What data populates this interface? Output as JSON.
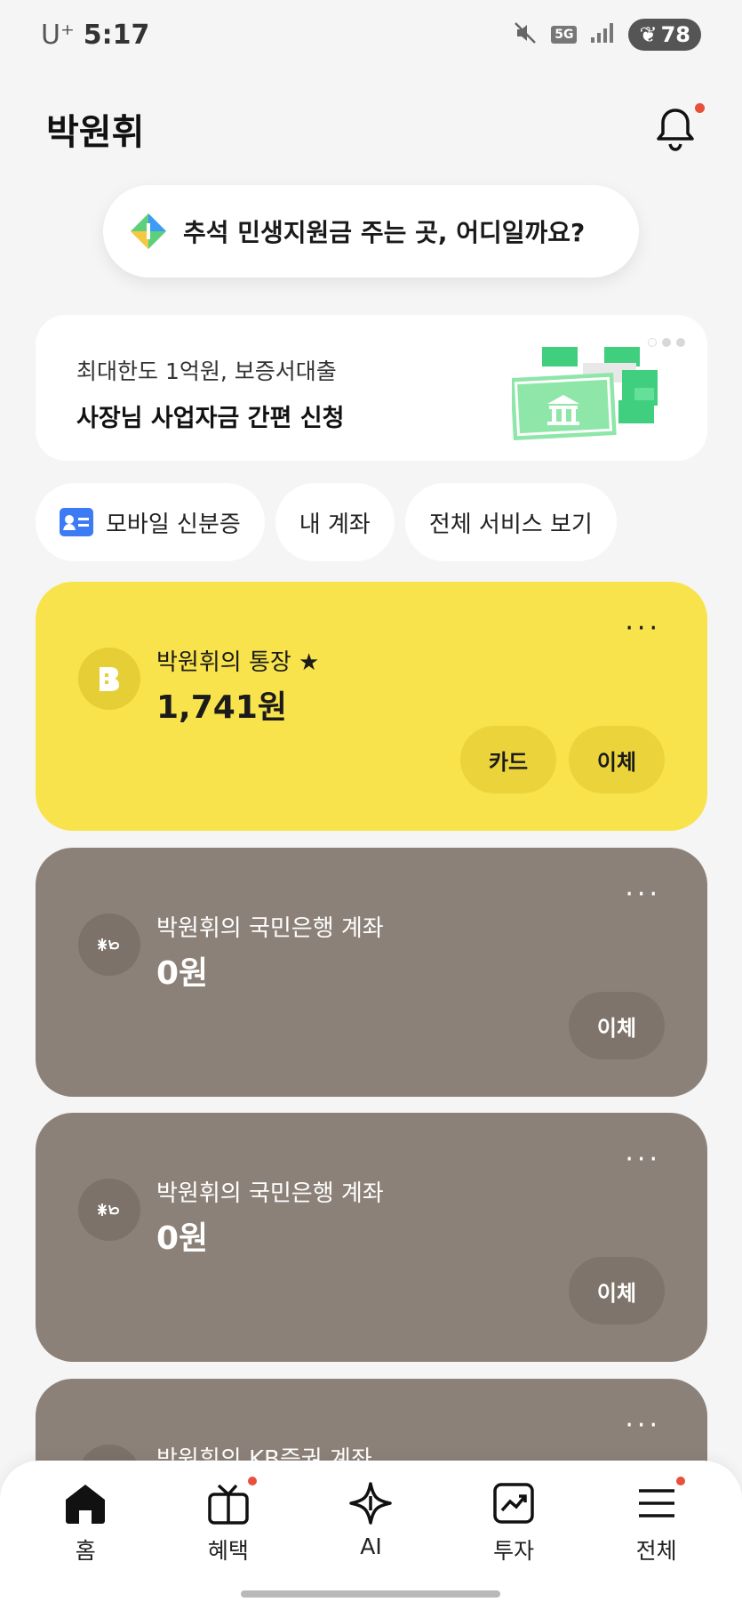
{
  "status_bar": {
    "carrier": "U⁺",
    "time": "5:17",
    "network": "5G",
    "battery": "78"
  },
  "header": {
    "title": "박원휘"
  },
  "promo_pill": {
    "text": "추석 민생지원금 주는 곳, 어디일까요?"
  },
  "banner": {
    "subtitle": "최대한도 1억원, 보증서대출",
    "title": "사장님 사업자금 간편 신청"
  },
  "chips": [
    {
      "label": "모바일 신분증",
      "icon": "id-card-icon"
    },
    {
      "label": "내 계좌"
    },
    {
      "label": "전체 서비스 보기"
    }
  ],
  "accounts": [
    {
      "name": "박원휘의 통장 ★",
      "amount": "1,741원",
      "buttons": [
        "카드",
        "이체"
      ],
      "color": "#f8e34c",
      "logo": "kakaobank-logo"
    },
    {
      "name": "박원휘의 국민은행 계좌",
      "amount": "0원",
      "buttons": [
        "이체"
      ],
      "color": "#8c8178",
      "logo": "kb-logo"
    },
    {
      "name": "박원휘의 국민은행 계좌",
      "amount": "0원",
      "buttons": [
        "이체"
      ],
      "color": "#8c8178",
      "logo": "kb-logo"
    },
    {
      "name": "박원휘의 KB증권 계좌",
      "color": "#8c8178",
      "logo": "kb-logo"
    }
  ],
  "more_label": "···",
  "bottom_nav": [
    {
      "label": "홈",
      "icon": "home-icon"
    },
    {
      "label": "혜택",
      "icon": "gift-icon",
      "badge": true
    },
    {
      "label": "AI",
      "icon": "ai-sparkle-icon"
    },
    {
      "label": "투자",
      "icon": "chart-icon"
    },
    {
      "label": "전체",
      "icon": "menu-icon",
      "badge": true
    }
  ]
}
